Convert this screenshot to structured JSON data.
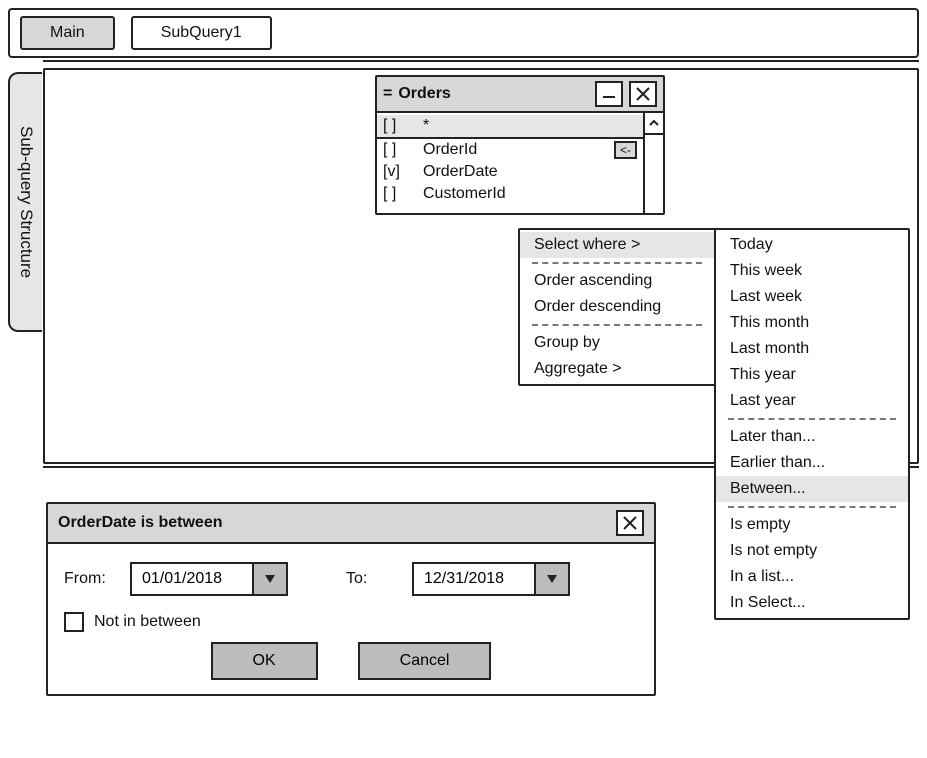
{
  "tabs": {
    "main": "Main",
    "sub": "SubQuery1"
  },
  "sidetab": "Sub-query Structure",
  "tableWindow": {
    "title": "Orders",
    "columns": [
      {
        "check": "[ ]",
        "name": "*"
      },
      {
        "check": "[ ]",
        "name": "OrderId",
        "key": "<-"
      },
      {
        "check": "[v]",
        "name": "OrderDate"
      },
      {
        "check": "[ ]",
        "name": "CustomerId"
      }
    ]
  },
  "contextMenu": {
    "selectWhere": "Select where >",
    "orderAsc": "Order ascending",
    "orderDesc": "Order descending",
    "groupBy": "Group by",
    "aggregate": "Aggregate >"
  },
  "whereMenu": {
    "today": "Today",
    "thisWeek": "This week",
    "lastWeek": "Last week",
    "thisMonth": "This month",
    "lastMonth": "Last month",
    "thisYear": "This year",
    "lastYear": "Last year",
    "laterThan": "Later than...",
    "earlierThan": "Earlier than...",
    "between": "Between...",
    "isEmpty": "Is empty",
    "isNotEmpty": "Is not empty",
    "inList": "In a list...",
    "inSelect": "In Select..."
  },
  "dialog": {
    "title": "OrderDate is between",
    "fromLabel": "From:",
    "toLabel": "To:",
    "fromValue": "01/01/2018",
    "toValue": "12/31/2018",
    "notBetween": "Not in between",
    "ok": "OK",
    "cancel": "Cancel"
  }
}
